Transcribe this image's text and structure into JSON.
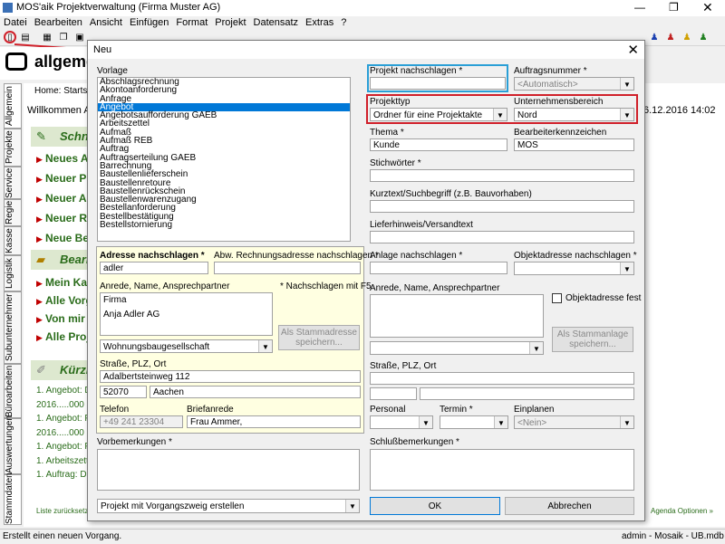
{
  "app": {
    "title": "MOS'aik Projektverwaltung (Firma Muster AG)",
    "menu": [
      "Datei",
      "Bearbeiten",
      "Ansicht",
      "Einfügen",
      "Format",
      "Projekt",
      "Datensatz",
      "Extras",
      "?"
    ],
    "header": "allgeme",
    "breadcrumb": "Home: Startseite",
    "welcome": "Willkommen Ac",
    "date": "6.12.2016 14:02",
    "side_tabs": [
      "Allgemein",
      "Projekte",
      "Service",
      "Regie",
      "Kasse",
      "Logistik",
      "Subunternehmer",
      "Büroarbeiten",
      "Auswertungen",
      "Stammdaten"
    ],
    "section1": "Schne",
    "links1": [
      "Neues Ar",
      "Neuer Pr",
      "Neuer Ar",
      "Neuer Re",
      "Neue Be"
    ],
    "section2": "Bearb",
    "links2": [
      "Mein Kal",
      "Alle Vorg",
      "Von mir b",
      "Alle Proje"
    ],
    "section3": "Kürzl",
    "recent": [
      "1. Angebot: Di",
      "2016.....000",
      "1. Angebot: Fi",
      "2016.....000",
      "1. Angebot: Fi",
      "1. Arbeitszette",
      "1. Auftrag: Div"
    ],
    "back_link": "Liste zurücksetzen",
    "agenda_link": "Agenda Optionen »",
    "status_left": "Erstellt einen neuen Vorgang.",
    "status_right": "admin - Mosaik - UB.mdb"
  },
  "dialog": {
    "title": "Neu",
    "vorlage_label": "Vorlage",
    "vorlage_items": [
      "Abschlagsrechnung",
      "Akontoanforderung",
      "Anfrage",
      "Angebot",
      "Angebotsaufforderung GAEB",
      "Arbeitszettel",
      "Aufmaß",
      "Aufmaß REB",
      "Auftrag",
      "Auftragserteilung GAEB",
      "Barrechnung",
      "Baustellenlieferschein",
      "Baustellenretoure",
      "Baustellenrückschein",
      "Baustellenwarenzugang",
      "Bestellanforderung",
      "Bestellbestätigung",
      "Bestellstornierung"
    ],
    "vorlage_selected": "Angebot",
    "projekt_label": "Projekt nachschlagen *",
    "projekt_value": "",
    "auftrag_label": "Auftragsnummer *",
    "auftrag_value": "<Automatisch>",
    "projekttyp_label": "Projekttyp",
    "projekttyp_value": "Ordner für eine Projektakte",
    "bereich_label": "Unternehmensbereich",
    "bereich_value": "Nord",
    "thema_label": "Thema *",
    "thema_value": "Kunde",
    "bearbeiter_label": "Bearbeiterkennzeichen",
    "bearbeiter_value": "MOS",
    "stichwoerter_label": "Stichwörter *",
    "kurztext_label": "Kurztext/Suchbegriff (z.B. Bauvorhaben)",
    "lieferhinweis_label": "Lieferhinweis/Versandtext",
    "adresse_label": "Adresse nachschlagen *",
    "adresse_value": "adler",
    "abw_label": "Abw. Rechnungsadresse nachschlagen *",
    "anrede_label": "Anrede, Name, Ansprechpartner",
    "f5_hint": "* Nachschlagen mit F5",
    "anrede_lines": [
      "Firma",
      "Anja Adler AG"
    ],
    "gruppe_value": "Wohnungsbaugesellschaft",
    "stammadresse_button": "Als Stammadresse speichern...",
    "strasse_label": "Straße, PLZ, Ort",
    "strasse_value": "Adalbertsteinweg 112",
    "plz_value": "52070",
    "ort_value": "Aachen",
    "telefon_label": "Telefon",
    "telefon_value": "+49 241 23304",
    "briefanrede_label": "Briefanrede",
    "briefanrede_value": "Frau Ammer,",
    "anlage_label": "Anlage nachschlagen *",
    "objekt_label": "Objektadresse nachschlagen *",
    "anrede2_label": "Anrede, Name, Ansprechpartner",
    "objekt_fest_label": "Objektadresse fest",
    "stammanlage_button": "Als Stammanlage speichern...",
    "strasse2_label": "Straße, PLZ, Ort",
    "personal_label": "Personal",
    "termin_label": "Termin *",
    "einplanen_label": "Einplanen",
    "einplanen_value": "<Nein>",
    "vorbem_label": "Vorbemerkungen *",
    "schluss_label": "Schlußbemerkungen *",
    "create_option": "Projekt mit Vorgangszweig erstellen",
    "ok_button": "OK",
    "cancel_button": "Abbrechen"
  }
}
